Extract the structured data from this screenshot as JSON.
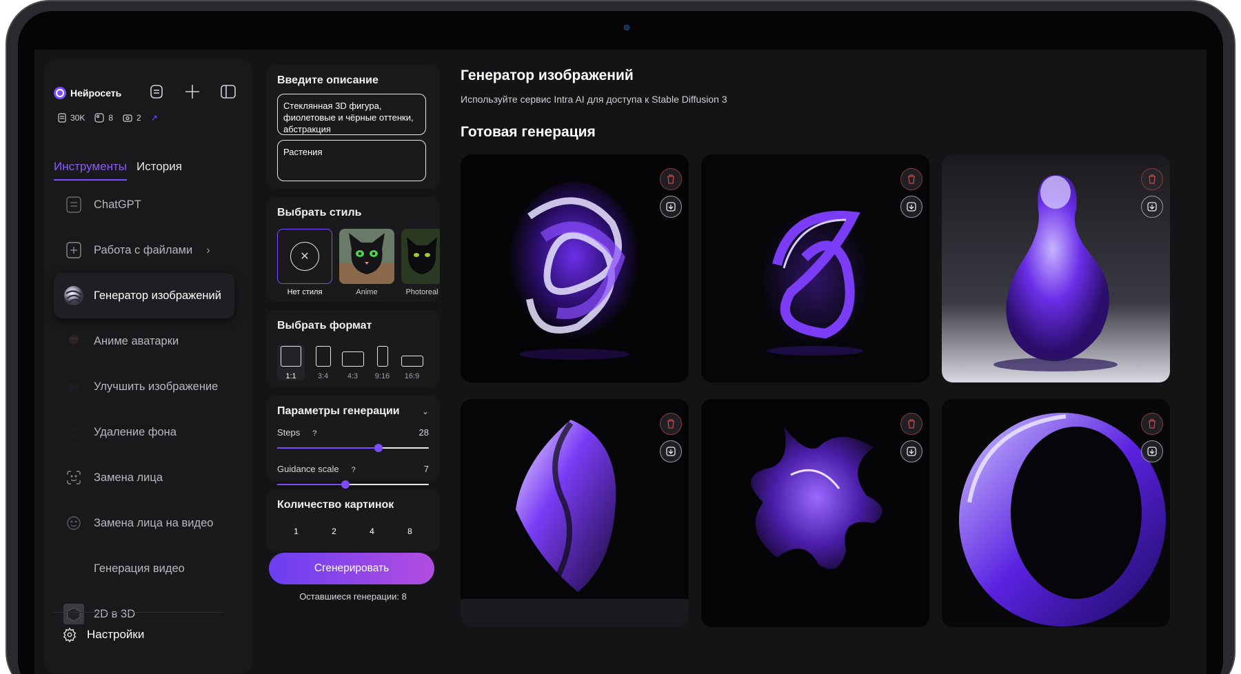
{
  "sidebar": {
    "brand": "Нейросеть",
    "stats": {
      "docs": "30K",
      "images": "8",
      "videos": "2"
    },
    "tabs": [
      {
        "label": "Инструменты",
        "active": true
      },
      {
        "label": "История",
        "active": false
      }
    ],
    "items": [
      {
        "label": "ChatGPT",
        "icon": "chat-doc-icon"
      },
      {
        "label": "Работа с файлами",
        "icon": "file-plus-icon"
      },
      {
        "label": "Генератор изображений",
        "icon": "image-gen-thumb",
        "active": true
      },
      {
        "label": "Аниме аватарки",
        "icon": "anime-avatar-icon"
      },
      {
        "label": "Улучшить изображение",
        "icon": "enhance-icon"
      },
      {
        "label": "Удаление фона",
        "icon": "bg-remove-icon"
      },
      {
        "label": "Замена лица",
        "icon": "face-swap-icon"
      },
      {
        "label": "Замена лица на видео",
        "icon": "face-swap-video-icon"
      },
      {
        "label": "Генерация видео",
        "icon": "video-gen-icon"
      },
      {
        "label": "2D в 3D",
        "icon": "cube-icon"
      }
    ],
    "settings": "Настройки"
  },
  "form": {
    "description_title": "Введите описание",
    "prompt": "Стеклянная 3D фигура, фиолетовые и чёрные оттенки, абстракция",
    "negative_prompt": "Растения",
    "style_title": "Выбрать стиль",
    "styles": [
      {
        "label": "Нет стиля",
        "selected": true
      },
      {
        "label": "Anime"
      },
      {
        "label": "Photoreal"
      }
    ],
    "format_title": "Выбрать формат",
    "formats": [
      {
        "label": "1:1",
        "selected": true
      },
      {
        "label": "3:4"
      },
      {
        "label": "4:3"
      },
      {
        "label": "9:16"
      },
      {
        "label": "16:9"
      }
    ],
    "params_title": "Параметры генерации",
    "steps": {
      "label": "Steps",
      "help": "?",
      "value": "28",
      "fraction": 0.67
    },
    "guidance": {
      "label": "Guidance scale",
      "help": "?",
      "value": "7",
      "fraction": 0.45
    },
    "count_title": "Количество картинок",
    "counts": [
      "1",
      "2",
      "4",
      "8"
    ],
    "generate_label": "Сгенерировать",
    "remaining": "Оставшиеся генерации: 8"
  },
  "main": {
    "title": "Генератор изображений",
    "subtitle": "Используйте сервис Intra AI для доступа к Stable Diffusion 3",
    "ready_title": "Готовая генерация",
    "images": [
      "glass-knot",
      "glass-loop",
      "glass-vase",
      "glass-swirl",
      "glass-splash",
      "glass-ring"
    ]
  },
  "colors": {
    "accent": "#7c4dff",
    "bg": "#141417",
    "panel": "#1a1a1d"
  }
}
